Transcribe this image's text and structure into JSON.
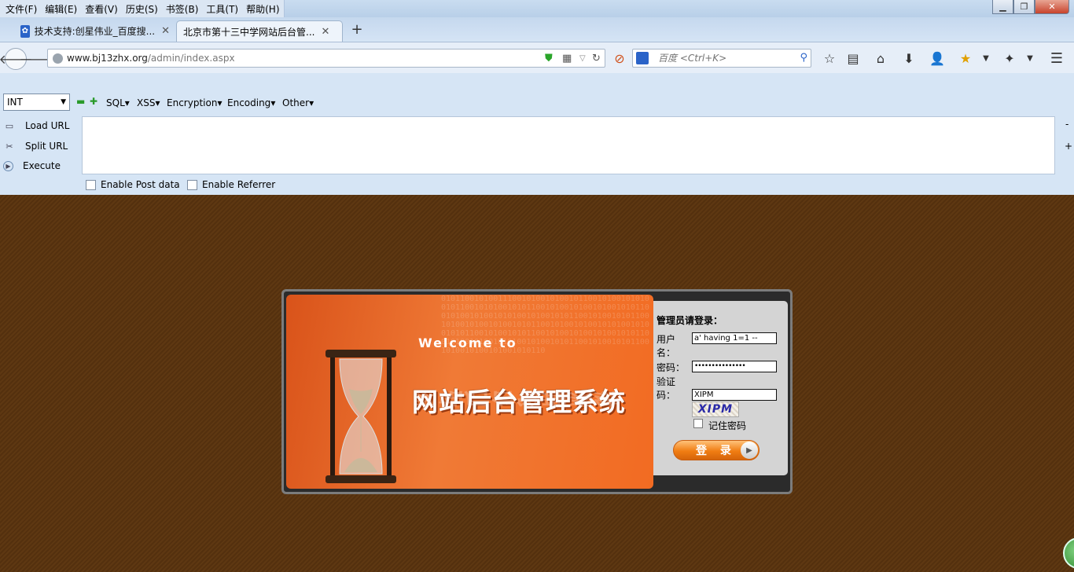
{
  "menubar": {
    "items": [
      "文件(F)",
      "编辑(E)",
      "查看(V)",
      "历史(S)",
      "书签(B)",
      "工具(T)",
      "帮助(H)"
    ]
  },
  "tabs": [
    {
      "label": "技术支持:创星伟业_百度搜...",
      "favicon": "baidu-paw-icon",
      "active": false
    },
    {
      "label": "北京市第十三中学网站后台管...",
      "favicon": "",
      "active": true
    }
  ],
  "navbar": {
    "url_host": "www.bj13zhx.org",
    "url_path": "/admin/index.aspx",
    "search_placeholder": "百度 <Ctrl+K>"
  },
  "hackbar": {
    "type_select": "INT",
    "menus": [
      "SQL",
      "XSS",
      "Encryption",
      "Encoding",
      "Other"
    ],
    "side_buttons": [
      "Load URL",
      "Split URL",
      "Execute"
    ],
    "textarea_value": "",
    "checkboxes": [
      "Enable Post data",
      "Enable Referrer"
    ],
    "minus": "-",
    "plus": "+"
  },
  "login": {
    "banner_welcome": "Welcome to",
    "banner_title": "网站后台管理系统",
    "heading": "管理员请登录：",
    "username_label_1": "用户",
    "username_label_2": "名：",
    "username_value": "a' having 1=1 --",
    "password_label": "密码：",
    "password_value": "•••••••••••••••",
    "captcha_label_1": "验证",
    "captcha_label_2": "码：",
    "captcha_value": "XIPM",
    "captcha_image_text": "XIPM",
    "remember_label": "记住密码",
    "login_button": "登 录"
  },
  "colors": {
    "page_background": "#5b3510",
    "hackbar_background": "#d6e5f5",
    "banner_orange": "#f26b22"
  }
}
